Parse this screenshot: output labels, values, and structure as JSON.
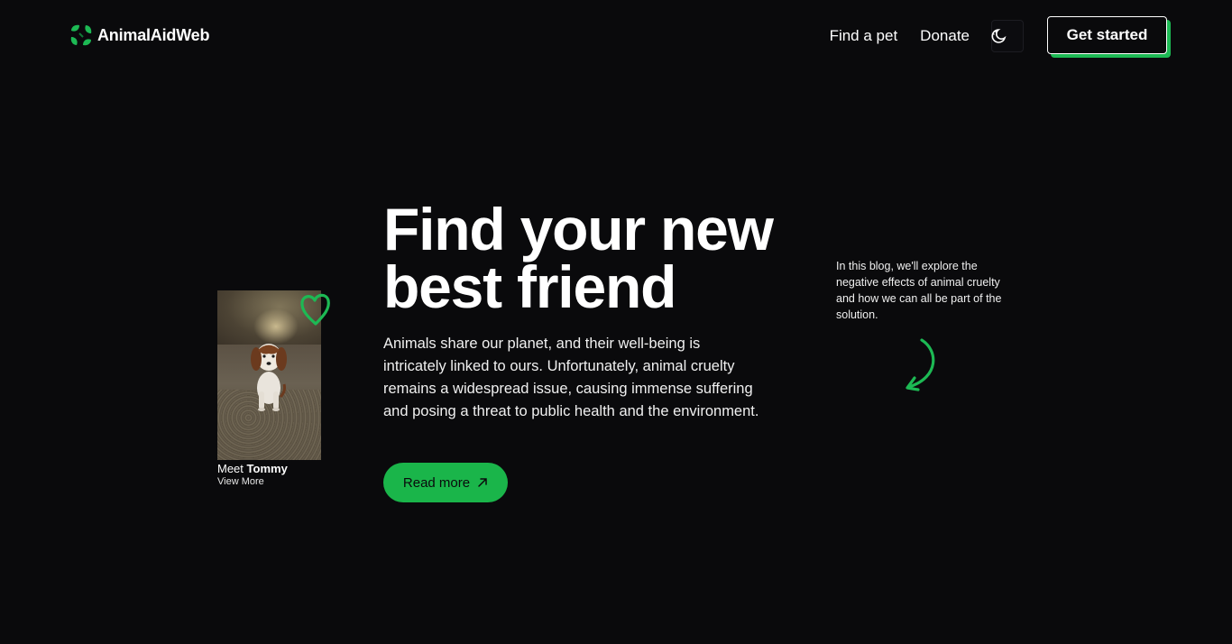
{
  "header": {
    "logo_text": "AnimalAidWeb",
    "nav": [
      {
        "label": "Find a pet"
      },
      {
        "label": "Donate"
      }
    ],
    "theme_toggle_icon": "moon-icon",
    "cta_label": "Get started"
  },
  "pet_card": {
    "caption_prefix": "Meet",
    "pet_name": "Tommy",
    "link_label": "View More",
    "favorite_icon": "heart-icon"
  },
  "hero": {
    "title_line1": "Find your new",
    "title_line2": "best friend",
    "description": "Animals share our planet, and their well-being is intricately linked to ours. Unfortunately, animal cruelty remains a widespread issue, causing immense suffering and posing a threat to public health and the environment.",
    "button_label": "Read more",
    "button_icon": "arrow-up-right-icon"
  },
  "side_note": {
    "text": "In this blog, we'll explore the negative effects of animal cruelty and how we can all be part of the solution.",
    "icon": "curved-arrow-icon"
  },
  "colors": {
    "background": "#0a0a0c",
    "accent": "#1ab54a",
    "text": "#ffffff"
  }
}
